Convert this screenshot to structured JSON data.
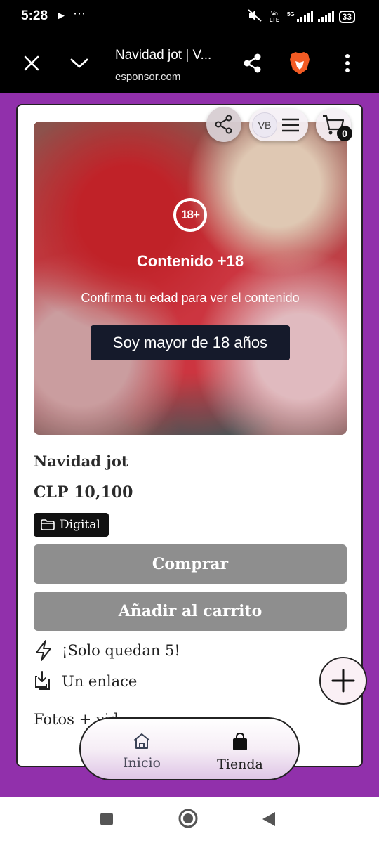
{
  "status_bar": {
    "time": "5:28",
    "network_1": "Vo LTE",
    "network_2": "5G",
    "battery": "33"
  },
  "browser": {
    "page_title": "Navidad jot | V...",
    "url": "esponsor.com",
    "accent_color": "#f25b24"
  },
  "header": {
    "user_initials": "VB",
    "cart_count": "0"
  },
  "media": {
    "badge": "18+",
    "title": "Contenido +18",
    "subtitle": "Confirma tu edad para ver el contenido",
    "confirm_label": "Soy mayor de 18 años"
  },
  "product": {
    "name": "Navidad jot",
    "price": "CLP 10,100",
    "tag": "Digital",
    "buy_label": "Comprar",
    "add_to_cart_label": "Añadir al carrito",
    "stock_note": "¡Solo quedan 5!",
    "delivery_note": "Un enlace",
    "section_partial": "Fotos + vid"
  },
  "bottom_nav": {
    "home_label": "Inicio",
    "shop_label": "Tienda"
  },
  "colors": {
    "page_bg": "#9130ab",
    "button_grey": "#8e8e8e",
    "dark_button": "#151a2a"
  }
}
